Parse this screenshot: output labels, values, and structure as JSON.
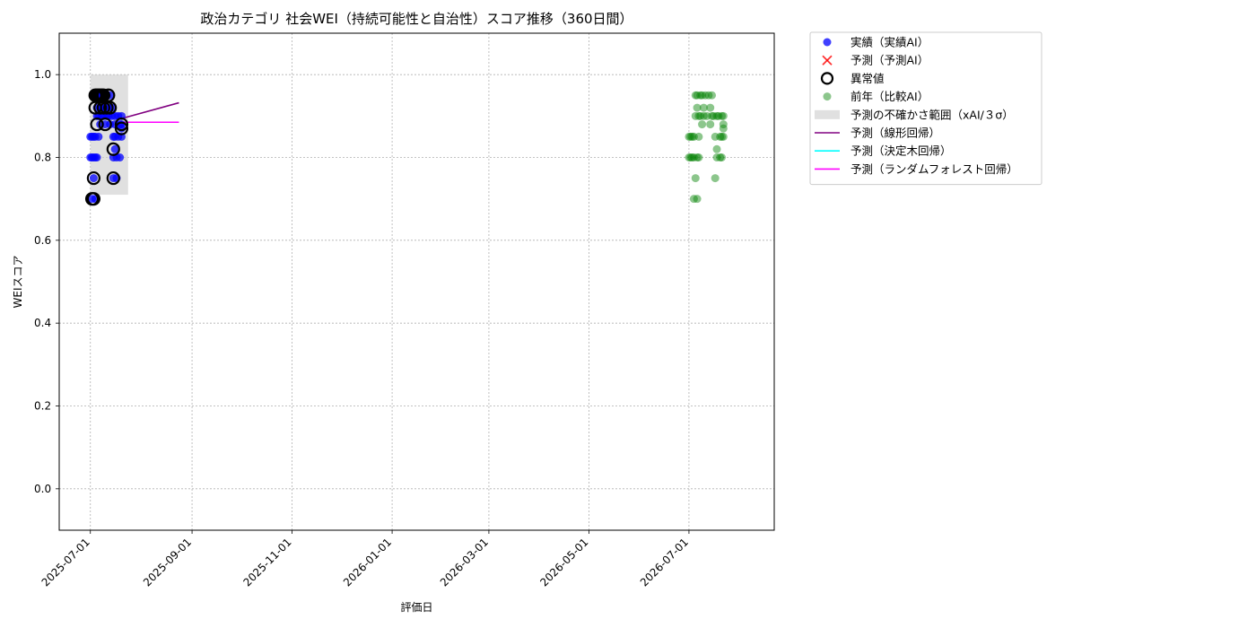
{
  "chart_data": {
    "type": "scatter",
    "title": "政治カテゴリ 社会WEI（持続可能性と自治性）スコア推移（360日間）",
    "xlabel": "評価日",
    "ylabel": "WEIスコア",
    "xlim": [
      "2025-06-12",
      "2026-08-22"
    ],
    "ylim": [
      -0.1,
      1.1
    ],
    "x_ticks": [
      "2025-07-01",
      "2025-09-01",
      "2025-11-01",
      "2026-01-01",
      "2026-03-01",
      "2026-05-01",
      "2026-07-01"
    ],
    "y_ticks": [
      0.0,
      0.2,
      0.4,
      0.6,
      0.8,
      1.0
    ],
    "y_tick_labels": [
      "0.0",
      "0.2",
      "0.4",
      "0.6",
      "0.8",
      "1.0"
    ],
    "grid": true,
    "legend_position": "outside-right",
    "legend": [
      {
        "label": "実績（実績AI）",
        "kind": "dot",
        "color": "#0000ff"
      },
      {
        "label": "予測（予測AI）",
        "kind": "cross",
        "color": "#ff0000"
      },
      {
        "label": "異常値",
        "kind": "ring",
        "color": "#000000"
      },
      {
        "label": "前年（比較AI）",
        "kind": "dot-faded",
        "color": "#008000"
      },
      {
        "label": "予測の不確かさ範囲（xAI/３σ）",
        "kind": "band",
        "color": "#cccccc"
      },
      {
        "label": "予測（線形回帰）",
        "kind": "line",
        "color": "#800080"
      },
      {
        "label": "予測（決定木回帰）",
        "kind": "line",
        "color": "#00ffff"
      },
      {
        "label": "予測（ランダムフォレスト回帰）",
        "kind": "line",
        "color": "#ff00ff"
      }
    ],
    "series": [
      {
        "name": "実績（実績AI）",
        "color": "#0000ff",
        "points": [
          [
            "2025-07-01",
            0.85
          ],
          [
            "2025-07-01",
            0.8
          ],
          [
            "2025-07-02",
            0.85
          ],
          [
            "2025-07-02",
            0.8
          ],
          [
            "2025-07-02",
            0.7
          ],
          [
            "2025-07-03",
            0.8
          ],
          [
            "2025-07-03",
            0.85
          ],
          [
            "2025-07-03",
            0.75
          ],
          [
            "2025-07-04",
            0.7
          ],
          [
            "2025-07-04",
            0.8
          ],
          [
            "2025-07-04",
            0.85
          ],
          [
            "2025-07-04",
            0.95
          ],
          [
            "2025-07-05",
            0.8
          ],
          [
            "2025-07-05",
            0.9
          ],
          [
            "2025-07-05",
            0.92
          ],
          [
            "2025-07-05",
            0.95
          ],
          [
            "2025-07-06",
            0.95
          ],
          [
            "2025-07-06",
            0.9
          ],
          [
            "2025-07-06",
            0.85
          ],
          [
            "2025-07-07",
            0.92
          ],
          [
            "2025-07-07",
            0.88
          ],
          [
            "2025-07-07",
            0.95
          ],
          [
            "2025-07-08",
            0.9
          ],
          [
            "2025-07-08",
            0.95
          ],
          [
            "2025-07-08",
            0.92
          ],
          [
            "2025-07-09",
            0.95
          ],
          [
            "2025-07-09",
            0.9
          ],
          [
            "2025-07-10",
            0.92
          ],
          [
            "2025-07-10",
            0.95
          ],
          [
            "2025-07-10",
            0.88
          ],
          [
            "2025-07-11",
            0.9
          ],
          [
            "2025-07-11",
            0.95
          ],
          [
            "2025-07-12",
            0.92
          ],
          [
            "2025-07-12",
            0.9
          ],
          [
            "2025-07-13",
            0.95
          ],
          [
            "2025-07-13",
            0.88
          ],
          [
            "2025-07-14",
            0.9
          ],
          [
            "2025-07-14",
            0.92
          ],
          [
            "2025-07-15",
            0.85
          ],
          [
            "2025-07-15",
            0.8
          ],
          [
            "2025-07-15",
            0.75
          ],
          [
            "2025-07-16",
            0.85
          ],
          [
            "2025-07-16",
            0.88
          ],
          [
            "2025-07-16",
            0.82
          ],
          [
            "2025-07-16",
            0.9
          ],
          [
            "2025-07-17",
            0.8
          ],
          [
            "2025-07-17",
            0.75
          ],
          [
            "2025-07-18",
            0.85
          ],
          [
            "2025-07-18",
            0.9
          ],
          [
            "2025-07-19",
            0.8
          ],
          [
            "2025-07-19",
            0.88
          ],
          [
            "2025-07-20",
            0.88
          ],
          [
            "2025-07-20",
            0.85
          ],
          [
            "2025-07-20",
            0.9
          ],
          [
            "2025-07-20",
            0.87
          ]
        ]
      },
      {
        "name": "異常値",
        "color": "#000000",
        "points": [
          [
            "2025-07-02",
            0.7
          ],
          [
            "2025-07-03",
            0.7
          ],
          [
            "2025-07-03",
            0.75
          ],
          [
            "2025-07-04",
            0.92
          ],
          [
            "2025-07-04",
            0.95
          ],
          [
            "2025-07-05",
            0.95
          ],
          [
            "2025-07-05",
            0.88
          ],
          [
            "2025-07-06",
            0.95
          ],
          [
            "2025-07-07",
            0.95
          ],
          [
            "2025-07-07",
            0.92
          ],
          [
            "2025-07-08",
            0.95
          ],
          [
            "2025-07-09",
            0.92
          ],
          [
            "2025-07-09",
            0.95
          ],
          [
            "2025-07-10",
            0.88
          ],
          [
            "2025-07-11",
            0.92
          ],
          [
            "2025-07-12",
            0.95
          ],
          [
            "2025-07-13",
            0.92
          ],
          [
            "2025-07-15",
            0.82
          ],
          [
            "2025-07-15",
            0.75
          ],
          [
            "2025-07-20",
            0.88
          ],
          [
            "2025-07-20",
            0.87
          ]
        ]
      },
      {
        "name": "前年（比較AI）",
        "color": "#008000",
        "points": [
          [
            "2026-07-01",
            0.85
          ],
          [
            "2026-07-01",
            0.8
          ],
          [
            "2026-07-02",
            0.8
          ],
          [
            "2026-07-02",
            0.85
          ],
          [
            "2026-07-03",
            0.8
          ],
          [
            "2026-07-03",
            0.85
          ],
          [
            "2026-07-04",
            0.7
          ],
          [
            "2026-07-04",
            0.8
          ],
          [
            "2026-07-04",
            0.85
          ],
          [
            "2026-07-05",
            0.95
          ],
          [
            "2026-07-05",
            0.9
          ],
          [
            "2026-07-05",
            0.75
          ],
          [
            "2026-07-06",
            0.92
          ],
          [
            "2026-07-06",
            0.95
          ],
          [
            "2026-07-06",
            0.8
          ],
          [
            "2026-07-06",
            0.7
          ],
          [
            "2026-07-07",
            0.9
          ],
          [
            "2026-07-07",
            0.85
          ],
          [
            "2026-07-07",
            0.8
          ],
          [
            "2026-07-08",
            0.95
          ],
          [
            "2026-07-08",
            0.9
          ],
          [
            "2026-07-09",
            0.88
          ],
          [
            "2026-07-09",
            0.95
          ],
          [
            "2026-07-10",
            0.92
          ],
          [
            "2026-07-10",
            0.9
          ],
          [
            "2026-07-11",
            0.95
          ],
          [
            "2026-07-12",
            0.9
          ],
          [
            "2026-07-13",
            0.95
          ],
          [
            "2026-07-14",
            0.92
          ],
          [
            "2026-07-14",
            0.88
          ],
          [
            "2026-07-15",
            0.9
          ],
          [
            "2026-07-15",
            0.95
          ],
          [
            "2026-07-16",
            0.9
          ],
          [
            "2026-07-17",
            0.85
          ],
          [
            "2026-07-17",
            0.75
          ],
          [
            "2026-07-18",
            0.9
          ],
          [
            "2026-07-18",
            0.82
          ],
          [
            "2026-07-18",
            0.8
          ],
          [
            "2026-07-19",
            0.9
          ],
          [
            "2026-07-20",
            0.8
          ],
          [
            "2026-07-20",
            0.85
          ],
          [
            "2026-07-21",
            0.9
          ],
          [
            "2026-07-21",
            0.85
          ],
          [
            "2026-07-21",
            0.8
          ],
          [
            "2026-07-22",
            0.88
          ],
          [
            "2026-07-22",
            0.87
          ],
          [
            "2026-07-22",
            0.85
          ],
          [
            "2026-07-22",
            0.9
          ]
        ]
      }
    ],
    "uncertainty_band": {
      "x_start": "2025-07-01",
      "x_end": "2025-07-24",
      "y_low": 0.71,
      "y_high": 1.0,
      "color": "#cccccc"
    },
    "forecast_lines": [
      {
        "name": "予測（線形回帰）",
        "color": "#800080",
        "points": [
          [
            "2025-07-21",
            0.895
          ],
          [
            "2025-08-24",
            0.932
          ]
        ]
      },
      {
        "name": "予測（ランダムフォレスト回帰）",
        "color": "#ff00ff",
        "points": [
          [
            "2025-07-21",
            0.885
          ],
          [
            "2025-08-24",
            0.885
          ]
        ]
      }
    ]
  }
}
